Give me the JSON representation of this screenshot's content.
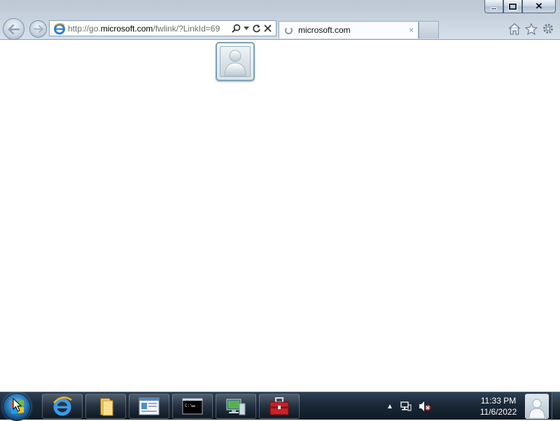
{
  "browser": {
    "address_prefix": "http://go.",
    "address_domain": "microsoft.com",
    "address_suffix": "/fwlink/?LinkId=69",
    "tab_title": "microsoft.com",
    "tab_close": "×"
  },
  "window_controls": {
    "close": "✕"
  },
  "taskbar": {
    "pinned": [
      "internet-explorer",
      "windows-explorer",
      "document-viewer",
      "command-prompt",
      "remote-desktop",
      "toolbox"
    ],
    "time": "11:33 PM",
    "date": "11/6/2022",
    "tray_chevron": "▲"
  }
}
